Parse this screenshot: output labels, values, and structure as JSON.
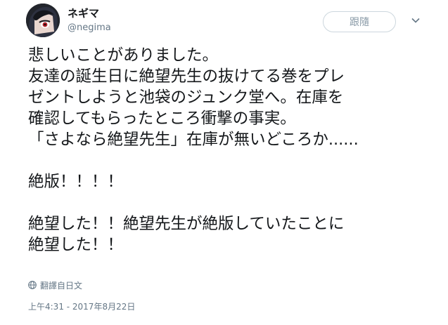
{
  "user": {
    "display_name": "ネギマ",
    "handle": "@negima",
    "avatar": "anime-character-avatar"
  },
  "actions": {
    "follow_label": "跟隨",
    "more_icon": "chevron-down-icon"
  },
  "tweet": {
    "lines": [
      "悲しいことがありました。",
      "友達の誕生日に絶望先生の抜けてる巻をプレ",
      "ゼントしようと池袋のジュンク堂へ。在庫を",
      "確認してもらったところ衝撃の事実。",
      "「さよなら絶望先生」在庫が無いどころか......",
      "",
      "絶版！！！！",
      "",
      "絶望した！！絶望先生が絶版していたことに",
      "絶望した！！"
    ]
  },
  "translate": {
    "icon": "globe-icon",
    "label": "翻譯自日文"
  },
  "timestamp": "上午4:31 - 2017年8月22日",
  "colors": {
    "text": "#14171a",
    "secondary": "#657786",
    "border": "#ccd6dd"
  }
}
